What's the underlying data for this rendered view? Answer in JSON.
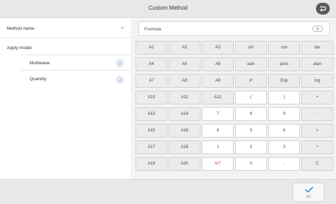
{
  "header": {
    "title": "Custom Method",
    "back_icon": "back-return-icon"
  },
  "left": {
    "method_name": "Method name",
    "apply_model": "Apply model",
    "options": [
      {
        "label": "Multiwave",
        "icon": "radio-check-icon"
      },
      {
        "label": "Quantity",
        "icon": "radio-check-icon"
      }
    ],
    "arrow": "»"
  },
  "formula": {
    "label": "Formula",
    "clear_icon": "clear-icon"
  },
  "keypad": {
    "rows": [
      [
        "A1",
        "A2",
        "A3",
        "sin",
        "cos",
        "tan"
      ],
      [
        "A4",
        "A5",
        "A6",
        "asin",
        "acos",
        "atan"
      ],
      [
        "A7",
        "A8",
        "A9",
        "x²",
        "Exp",
        "log"
      ],
      [
        "A10",
        "A11",
        "A12",
        "(",
        ")",
        "+"
      ],
      [
        "A13",
        "A14",
        "7",
        "8",
        "9",
        "-"
      ],
      [
        "A15",
        "A16",
        "4",
        "5",
        "6",
        "×"
      ],
      [
        "A17",
        "A18",
        "1",
        "2",
        "3",
        "÷"
      ],
      [
        "A19",
        "A20",
        "A/T",
        "0",
        ".",
        "C"
      ]
    ],
    "accent_color": "#d23b3b"
  },
  "footer": {
    "ok_label": "OK",
    "ok_icon": "checkmark-icon",
    "ok_color": "#2f8fd8"
  }
}
